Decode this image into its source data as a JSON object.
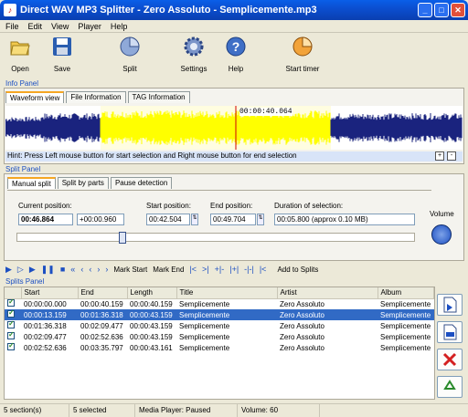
{
  "window": {
    "title": "Direct WAV MP3 Splitter - Zero Assoluto - Semplicemente.mp3",
    "min_label": "_",
    "max_label": "□",
    "close_label": "✕"
  },
  "menu": [
    "File",
    "Edit",
    "View",
    "Player",
    "Help"
  ],
  "toolbar": {
    "open": "Open",
    "save": "Save",
    "split": "Split",
    "settings": "Settings",
    "help": "Help",
    "start_timer": "Start timer"
  },
  "info_panel": {
    "label": "Info Panel",
    "tabs": [
      "Waveform view",
      "File Information",
      "TAG Information"
    ],
    "cursor_time": "00:00:40.064",
    "hint": "Hint: Press Left mouse button for start selection and Right mouse button for end selection"
  },
  "split_panel": {
    "label": "Split Panel",
    "tabs": [
      "Manual split",
      "Split by parts",
      "Pause detection"
    ],
    "current_position_label": "Current position:",
    "current_position": "00:46.864",
    "current_offset": "+00:00.960",
    "start_position_label": "Start position:",
    "start_position": "00:42.504",
    "end_position_label": "End position:",
    "end_position": "00:49.704",
    "duration_label": "Duration of selection:",
    "duration": "00:05.800 (approx 0.10 MB)",
    "volume_label": "Volume",
    "position_fraction": 0.26
  },
  "transport": {
    "buttons": [
      "▶",
      "▷",
      "▶",
      "❚❚",
      "■",
      "«",
      "‹",
      "‹",
      "›",
      "›"
    ],
    "mark_start": "Mark Start",
    "mark_end": "Mark End",
    "extra": [
      "|<",
      ">|",
      "+|-",
      "|+|",
      "-|-|",
      "|<"
    ],
    "add_to_splits": "Add to Splits"
  },
  "splits_panel": {
    "label": "Splits Panel",
    "columns": [
      "",
      "Start",
      "End",
      "Length",
      "Title",
      "Artist",
      "Album"
    ],
    "rows": [
      {
        "checked": true,
        "start": "00:00:00.000",
        "end": "00:00:40.159",
        "length": "00:00:40.159",
        "title": "Semplicemente",
        "artist": "Zero Assoluto",
        "album": "Semplicemente",
        "selected": false
      },
      {
        "checked": true,
        "start": "00:00:13.159",
        "end": "00:01:36.318",
        "length": "00:00:43.159",
        "title": "Semplicemente",
        "artist": "Zero Assoluto",
        "album": "Semplicemente",
        "selected": true
      },
      {
        "checked": true,
        "start": "00:01:36.318",
        "end": "00:02:09.477",
        "length": "00:00:43.159",
        "title": "Semplicemente",
        "artist": "Zero Assoluto",
        "album": "Semplicemente",
        "selected": false
      },
      {
        "checked": true,
        "start": "00:02:09.477",
        "end": "00:02:52.636",
        "length": "00:00:43.159",
        "title": "Semplicemente",
        "artist": "Zero Assoluto",
        "album": "Semplicemente",
        "selected": false
      },
      {
        "checked": true,
        "start": "00:02:52.636",
        "end": "00:03:35.797",
        "length": "00:00:43.161",
        "title": "Semplicemente",
        "artist": "Zero Assoluto",
        "album": "Semplicemente",
        "selected": false
      }
    ]
  },
  "status": {
    "sections": "5 section(s)",
    "selected": "5 selected",
    "player": "Media Player: Paused",
    "volume": "Volume: 60"
  },
  "colors": {
    "waveform": "#1a237e",
    "selection": "#ffff00",
    "accent": "#1c4fc2",
    "selected_row": "#316ac5"
  }
}
